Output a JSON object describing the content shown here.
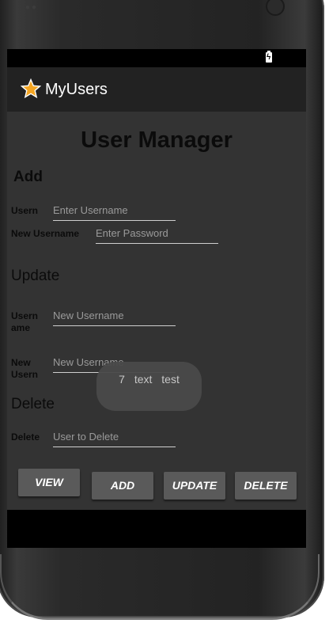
{
  "app": {
    "title": "MyUsers"
  },
  "main": {
    "heading": "User Manager",
    "add": {
      "section": "Add",
      "username_label": "Usern",
      "username_placeholder": "Enter Username",
      "password_label": "New Username",
      "password_placeholder": "Enter Password"
    },
    "update": {
      "section": "Update",
      "old_label": "Usern\name",
      "old_placeholder": "New Username",
      "new_label": "New\nUsern",
      "new_placeholder": "New Username"
    },
    "delete": {
      "section": "Delete",
      "label": "Delete",
      "placeholder": "User to Delete"
    },
    "buttons": {
      "view": "VIEW",
      "add": "ADD",
      "update": "UPDATE",
      "delete": "DELETE"
    }
  },
  "toast": {
    "count": "7",
    "word1": "text",
    "word2": "test"
  },
  "icons": {
    "app_icon": "star-icon",
    "battery": "battery-charging-icon"
  },
  "colors": {
    "actionbar": "#222222",
    "content": "#333333",
    "button": "#5a5a5a",
    "star": "#f5a623"
  }
}
